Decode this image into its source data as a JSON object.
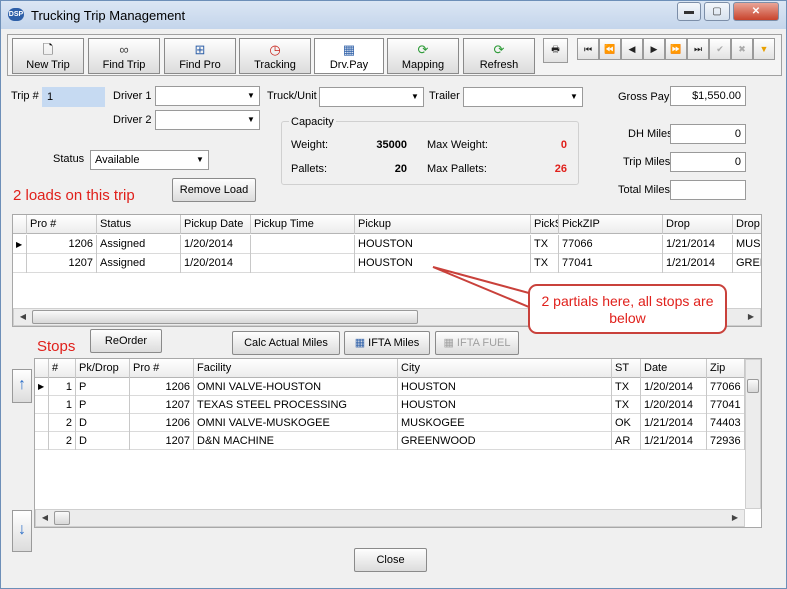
{
  "window": {
    "title": "Trucking Trip Management",
    "app_icon": "logo",
    "controls": {
      "minimize": "▬",
      "maximize": "▢",
      "close": "✕"
    }
  },
  "toolbar": {
    "buttons": [
      {
        "label": "New Trip",
        "icon": "document-icon"
      },
      {
        "label": "Find Trip",
        "icon": "binoculars-icon"
      },
      {
        "label": "Find Pro",
        "icon": "org-chart-icon"
      },
      {
        "label": "Tracking",
        "icon": "clock-icon"
      },
      {
        "label": "Drv.Pay",
        "icon": "calculator-icon"
      },
      {
        "label": "Mapping",
        "icon": "refresh-icon"
      },
      {
        "label": "Refresh",
        "icon": "refresh-icon"
      }
    ],
    "nav": [
      {
        "icon": "print-icon",
        "glyph": "🖶"
      },
      {
        "icon": "first-icon",
        "glyph": "⏮"
      },
      {
        "icon": "prev-page-icon",
        "glyph": "⏪"
      },
      {
        "icon": "prev-icon",
        "glyph": "◀"
      },
      {
        "icon": "next-icon",
        "glyph": "▶"
      },
      {
        "icon": "next-page-icon",
        "glyph": "⏩"
      },
      {
        "icon": "last-icon",
        "glyph": "⏭"
      },
      {
        "icon": "check-icon",
        "glyph": "✔"
      },
      {
        "icon": "cancel-icon",
        "glyph": "✖"
      },
      {
        "icon": "filter-icon",
        "glyph": "▼"
      }
    ]
  },
  "form": {
    "trip_label": "Trip #",
    "trip_value": "1",
    "driver1_label": "Driver 1",
    "driver1_value": "",
    "driver2_label": "Driver 2",
    "driver2_value": "",
    "truck_label": "Truck/Unit",
    "truck_value": "",
    "trailer_label": "Trailer",
    "trailer_value": "",
    "status_label": "Status",
    "status_value": "Available",
    "gross_pay_label": "Gross Pay",
    "gross_pay_value": "$1,550.00",
    "dh_miles_label": "DH Miles",
    "dh_miles_value": "0",
    "trip_miles_label": "Trip Miles",
    "trip_miles_value": "0",
    "total_miles_label": "Total Miles",
    "total_miles_value": "",
    "dropdown_glyph": "▼"
  },
  "capacity": {
    "title": "Capacity",
    "weight_label": "Weight:",
    "weight_value": "35000",
    "max_weight_label": "Max Weight:",
    "max_weight_value": "0",
    "pallets_label": "Pallets:",
    "pallets_value": "20",
    "max_pallets_label": "Max Pallets:",
    "max_pallets_value": "26"
  },
  "loads": {
    "count_text": "2 loads on this trip",
    "remove_button": "Remove Load",
    "columns": [
      "Pro #",
      "Status",
      "Pickup Date",
      "Pickup Time",
      "Pickup",
      "PickS",
      "PickZIP",
      "Drop",
      "Drop"
    ],
    "rows": [
      {
        "pro": "1206",
        "status": "Assigned",
        "pickup_date": "1/20/2014",
        "pickup_time": "",
        "pickup": "HOUSTON",
        "pick_st": "TX",
        "pick_zip": "77066",
        "drop_date": "1/21/2014",
        "drop": "MUSI"
      },
      {
        "pro": "1207",
        "status": "Assigned",
        "pickup_date": "1/20/2014",
        "pickup_time": "",
        "pickup": "HOUSTON",
        "pick_st": "TX",
        "pick_zip": "77041",
        "drop_date": "1/21/2014",
        "drop": "GREE"
      }
    ]
  },
  "annotation": {
    "text": "2 partials here, all stops are below"
  },
  "stops": {
    "title": "Stops",
    "reorder_button": "ReOrder",
    "calc_button": "Calc Actual Miles",
    "ifta_miles_button": "IFTA Miles",
    "ifta_fuel_button": "IFTA FUEL",
    "columns": [
      "#",
      "Pk/Drop",
      "Pro #",
      "Facility",
      "City",
      "ST",
      "Date",
      "Zip"
    ],
    "rows": [
      {
        "num": "1",
        "pkdrop": "P",
        "pro": "1206",
        "facility": "OMNI VALVE-HOUSTON",
        "city": "HOUSTON",
        "st": "TX",
        "date": "1/20/2014",
        "zip": "77066"
      },
      {
        "num": "1",
        "pkdrop": "P",
        "pro": "1207",
        "facility": "TEXAS STEEL PROCESSING",
        "city": "HOUSTON",
        "st": "TX",
        "date": "1/20/2014",
        "zip": "77041"
      },
      {
        "num": "2",
        "pkdrop": "D",
        "pro": "1206",
        "facility": "OMNI VALVE-MUSKOGEE",
        "city": "MUSKOGEE",
        "st": "OK",
        "date": "1/21/2014",
        "zip": "74403"
      },
      {
        "num": "2",
        "pkdrop": "D",
        "pro": "1207",
        "facility": "D&N MACHINE",
        "city": "GREENWOOD",
        "st": "AR",
        "date": "1/21/2014",
        "zip": "72936"
      }
    ]
  },
  "close_button": "Close",
  "colors": {
    "accent": "#2d5fa8",
    "warning_text": "#e0201b",
    "selected_field": "#c6daf2"
  }
}
